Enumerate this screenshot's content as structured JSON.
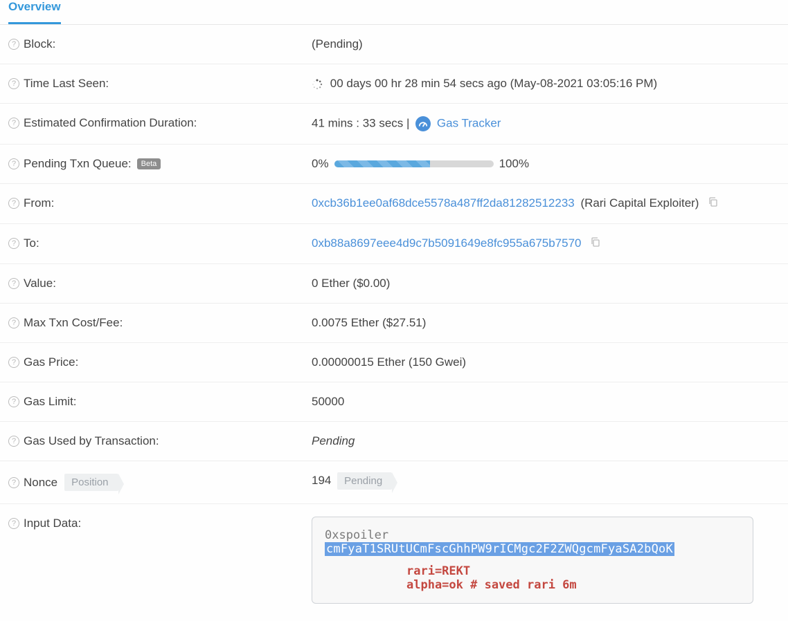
{
  "tab": {
    "overview": "Overview"
  },
  "labels": {
    "block": "Block:",
    "time_last_seen": "Time Last Seen:",
    "est_conf": "Estimated Confirmation Duration:",
    "pending_queue": "Pending Txn Queue:",
    "from": "From:",
    "to": "To:",
    "value": "Value:",
    "max_fee": "Max Txn Cost/Fee:",
    "gas_price": "Gas Price:",
    "gas_limit": "Gas Limit:",
    "gas_used": "Gas Used by Transaction:",
    "nonce": "Nonce",
    "position": "Position",
    "input_data": "Input Data:",
    "beta": "Beta"
  },
  "block": {
    "status": "(Pending)"
  },
  "time_last_seen": {
    "text": "00 days 00 hr 28 min 54 secs ago (May-08-2021 03:05:16 PM)"
  },
  "est_conf": {
    "duration": "41 mins : 33 secs",
    "separator": " | ",
    "gas_tracker_label": "Gas Tracker"
  },
  "queue": {
    "left": "0%",
    "right": "100%",
    "fill_percent": 60
  },
  "from": {
    "address": "0xcb36b1ee0af68dce5578a487ff2da81282512233",
    "tag": "(Rari Capital Exploiter)"
  },
  "to": {
    "address": "0xb88a8697eee4d9c7b5091649e8fc955a675b7570"
  },
  "value": {
    "text": "0 Ether ($0.00)"
  },
  "max_fee": {
    "text": "0.0075 Ether ($27.51)"
  },
  "gas_price": {
    "text": "0.00000015 Ether (150 Gwei)"
  },
  "gas_limit": {
    "text": "50000"
  },
  "gas_used": {
    "text": "Pending"
  },
  "nonce": {
    "value": "194",
    "position_status": "Pending"
  },
  "input_data": {
    "prefix": "0xspoiler",
    "highlighted": "cmFyaT1SRUtUCmFscGhhPW9rICMgc2F2ZWQgcmFyaSA2bQoK",
    "decoded_line1": "rari=REKT",
    "decoded_line2": "alpha=ok # saved rari 6m"
  }
}
